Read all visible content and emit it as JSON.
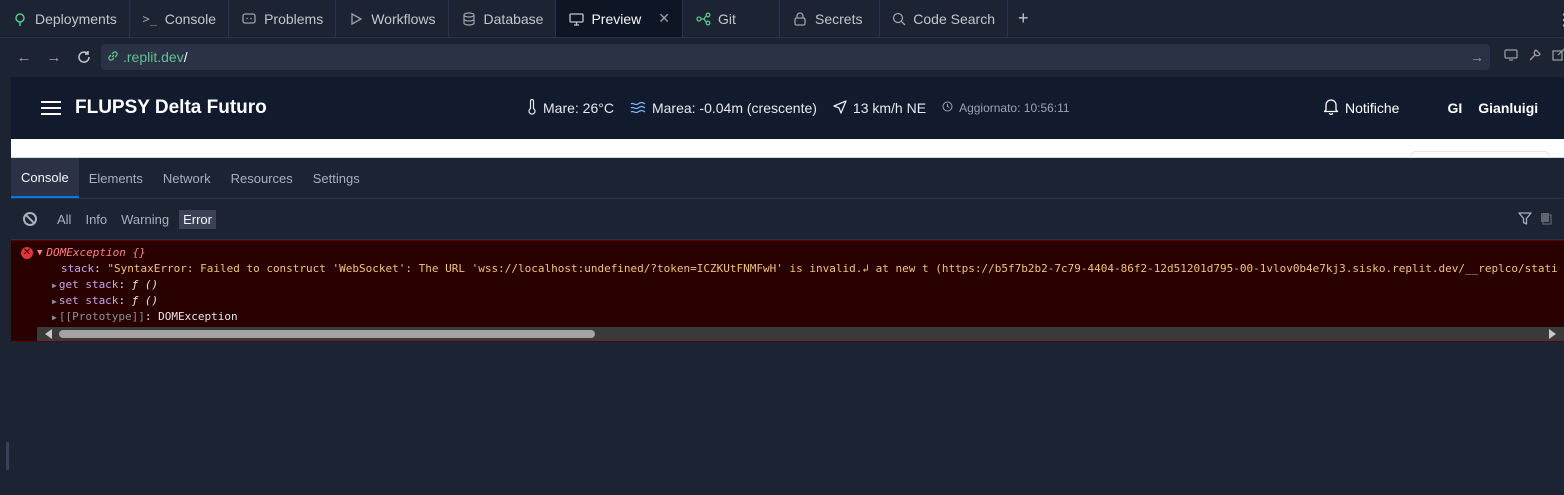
{
  "tabs": [
    {
      "icon": "deployments-icon",
      "label": "Deployments"
    },
    {
      "icon": "console-icon",
      "label": "Console"
    },
    {
      "icon": "problems-icon",
      "label": "Problems"
    },
    {
      "icon": "workflows-icon",
      "label": "Workflows"
    },
    {
      "icon": "database-icon",
      "label": "Database"
    },
    {
      "icon": "preview-icon",
      "label": "Preview",
      "active": true
    },
    {
      "icon": "git-icon",
      "label": "Git"
    },
    {
      "icon": "lock-icon",
      "label": "Secrets"
    },
    {
      "icon": "search-icon",
      "label": "Code Search"
    }
  ],
  "tab_add": "+",
  "url": {
    "host": ".replit.dev",
    "path": "/"
  },
  "app": {
    "title": "FLUPSY Delta Futuro",
    "weather": {
      "sea": "Mare: 26°C",
      "tide": "Marea: -0.04m (crescente)",
      "wind": "13 km/h NE",
      "updated": "Aggiornato: 10:56:11"
    },
    "notifications": "Notifiche",
    "user_initials": "GI",
    "user_name": "Gianluigi"
  },
  "devtools": {
    "tabs": [
      "Console",
      "Elements",
      "Network",
      "Resources",
      "Settings"
    ],
    "active_tab": "Console",
    "levels": [
      "All",
      "Info",
      "Warning",
      "Error"
    ],
    "selected_level": "Error"
  },
  "error": {
    "name": "DOMException {}",
    "stack_key": "stack",
    "stack_value": "\"SyntaxError: Failed to construct 'WebSocket': The URL 'wss://localhost:undefined/?token=ICZKUtFNMFwH' is invalid.↲ at new t (https://b5f7b2b2-7c79-4404-86f2-12d51201d795-00-1vlov0b4e7kj3.sisko.replit.dev/__replco/stati",
    "get_key": "get stack",
    "get_value": "ƒ ()",
    "set_key": "set stack",
    "set_value": "ƒ ()",
    "proto_key": "[[Prototype]]",
    "proto_value": "DOMException"
  },
  "colors": {
    "accent": "#0079f2",
    "error_bg": "#290000",
    "link_green": "#58c68a"
  }
}
